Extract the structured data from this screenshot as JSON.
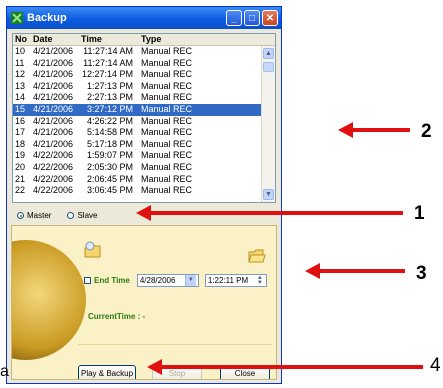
{
  "window": {
    "title": "Backup",
    "title_icon": "green-backup-icon"
  },
  "table": {
    "columns": [
      "No",
      "Date",
      "Time",
      "Type"
    ],
    "rows": [
      {
        "no": "10",
        "date": "4/21/2006",
        "time": "11:27:14 AM",
        "type": "Manual REC"
      },
      {
        "no": "11",
        "date": "4/21/2006",
        "time": "11:27:14 AM",
        "type": "Manual REC"
      },
      {
        "no": "12",
        "date": "4/21/2006",
        "time": "12:27:14 PM",
        "type": "Manual REC"
      },
      {
        "no": "13",
        "date": "4/21/2006",
        "time": "1:27:13 PM",
        "type": "Manual REC"
      },
      {
        "no": "14",
        "date": "4/21/2006",
        "time": "2:27:13 PM",
        "type": "Manual REC"
      },
      {
        "no": "15",
        "date": "4/21/2006",
        "time": "3:27:12 PM",
        "type": "Manual REC"
      },
      {
        "no": "16",
        "date": "4/21/2006",
        "time": "4:26:22 PM",
        "type": "Manual REC"
      },
      {
        "no": "17",
        "date": "4/21/2006",
        "time": "5:14:58 PM",
        "type": "Manual REC"
      },
      {
        "no": "18",
        "date": "4/21/2006",
        "time": "5:17:18 PM",
        "type": "Manual REC"
      },
      {
        "no": "19",
        "date": "4/22/2006",
        "time": "1:59:07 PM",
        "type": "Manual REC"
      },
      {
        "no": "20",
        "date": "4/22/2006",
        "time": "2:05:30 PM",
        "type": "Manual REC"
      },
      {
        "no": "21",
        "date": "4/22/2006",
        "time": "2:06:45 PM",
        "type": "Manual REC"
      },
      {
        "no": "22",
        "date": "4/22/2006",
        "time": "3:06:45 PM",
        "type": "Manual REC"
      }
    ],
    "selected_no": "15"
  },
  "mode": {
    "master_label": "Master",
    "slave_label": "Slave",
    "selected": "Master"
  },
  "end_time": {
    "label": "End Time",
    "date": "4/28/2006",
    "time": "1:22:11 PM",
    "checked": false
  },
  "current_time_label": "CurrentTime : -",
  "buttons": {
    "play_backup": "Play & Backup",
    "stop": "Stop",
    "close": "Close"
  },
  "callouts": {
    "one": "1",
    "two": "2",
    "three": "3",
    "four": "4",
    "side_letter": "a"
  },
  "colors": {
    "selection": "#316ac5",
    "arrow": "#e01010",
    "panel": "#fbf1c7",
    "accent_green": "#2b7c10"
  }
}
